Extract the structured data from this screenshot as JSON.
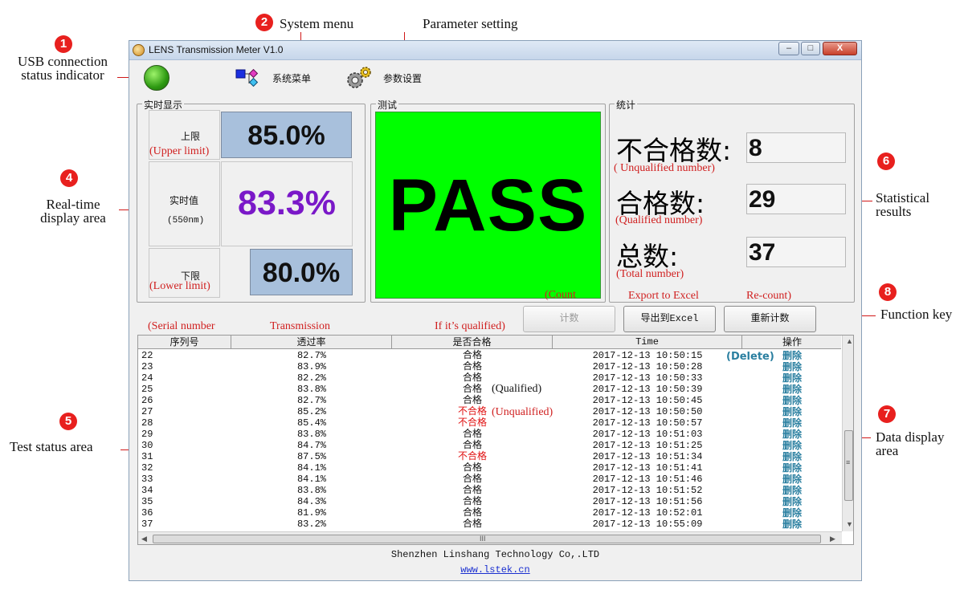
{
  "window": {
    "title": "LENS Transmission Meter V1.0",
    "minimize": "–",
    "maximize": "□",
    "close": "X"
  },
  "toolbar": {
    "system_menu": "系统菜单",
    "parameter_setting": "参数设置"
  },
  "realtime": {
    "group_title": "实时显示",
    "upper_label": "上限",
    "upper_value": "85.0%",
    "current_label": "实时值",
    "wavelength": "(550nm)",
    "current_value": "83.3%",
    "lower_label": "下限",
    "lower_value": "80.0%"
  },
  "test": {
    "group_title": "测试",
    "result": "PASS"
  },
  "stats": {
    "group_title": "统计",
    "unqualified_label": "不合格数:",
    "unqualified_value": "8",
    "qualified_label": "合格数:",
    "qualified_value": "29",
    "total_label": "总数:",
    "total_value": "37"
  },
  "function_buttons": {
    "count": "计数",
    "export": "导出到Excel",
    "recount": "重新计数"
  },
  "table": {
    "columns": [
      "序列号",
      "透过率",
      "是否合格",
      "Time",
      "操作"
    ],
    "rows": [
      {
        "id": "22",
        "trans": "82.7%",
        "status": "合格",
        "time": "2017-12-13  10:50:15",
        "action": "删除"
      },
      {
        "id": "23",
        "trans": "83.9%",
        "status": "合格",
        "time": "2017-12-13  10:50:28",
        "action": "删除"
      },
      {
        "id": "24",
        "trans": "82.2%",
        "status": "合格",
        "time": "2017-12-13  10:50:33",
        "action": "删除"
      },
      {
        "id": "25",
        "trans": "83.8%",
        "status": "合格",
        "time": "2017-12-13  10:50:39",
        "action": "删除"
      },
      {
        "id": "26",
        "trans": "82.7%",
        "status": "合格",
        "time": "2017-12-13  10:50:45",
        "action": "删除"
      },
      {
        "id": "27",
        "trans": "85.2%",
        "status": "不合格",
        "time": "2017-12-13  10:50:50",
        "action": "删除"
      },
      {
        "id": "28",
        "trans": "85.4%",
        "status": "不合格",
        "time": "2017-12-13  10:50:57",
        "action": "删除"
      },
      {
        "id": "29",
        "trans": "83.8%",
        "status": "合格",
        "time": "2017-12-13  10:51:03",
        "action": "删除"
      },
      {
        "id": "30",
        "trans": "84.7%",
        "status": "合格",
        "time": "2017-12-13  10:51:25",
        "action": "删除"
      },
      {
        "id": "31",
        "trans": "87.5%",
        "status": "不合格",
        "time": "2017-12-13  10:51:34",
        "action": "删除"
      },
      {
        "id": "32",
        "trans": "84.1%",
        "status": "合格",
        "time": "2017-12-13  10:51:41",
        "action": "删除"
      },
      {
        "id": "33",
        "trans": "84.1%",
        "status": "合格",
        "time": "2017-12-13  10:51:46",
        "action": "删除"
      },
      {
        "id": "34",
        "trans": "83.8%",
        "status": "合格",
        "time": "2017-12-13  10:51:52",
        "action": "删除"
      },
      {
        "id": "35",
        "trans": "84.3%",
        "status": "合格",
        "time": "2017-12-13  10:51:56",
        "action": "删除"
      },
      {
        "id": "36",
        "trans": "81.9%",
        "status": "合格",
        "time": "2017-12-13  10:52:01",
        "action": "删除"
      },
      {
        "id": "37",
        "trans": "83.2%",
        "status": "合格",
        "time": "2017-12-13  10:55:09",
        "action": "删除"
      }
    ],
    "hscroll_grip": "III",
    "vscroll_grip": "≡"
  },
  "footer": {
    "company": "Shenzhen Linshang Technology Co,.LTD",
    "url": "www.lstek.cn"
  },
  "annotations": {
    "badges": [
      "1",
      "2",
      "4",
      "5",
      "6",
      "7",
      "8"
    ],
    "usb": "USB connection status indicator",
    "system_menu": "System menu",
    "parameter_setting": "Parameter setting",
    "realtime": "Real-time display area",
    "test_status": "Test status area",
    "stats": "Statistical results",
    "data_display": "Data display area",
    "function_key": "Function key",
    "upper_limit": "(Upper limit)",
    "lower_limit": "(Lower limit)",
    "unqualified_number": "( Unqualified number)",
    "qualified_number": "(Qualified number)",
    "total_number": "(Total number)",
    "count": "(Count",
    "export": "Export to Excel",
    "recount": "Re-count)",
    "serial": "(Serial number",
    "transmission": "Transmission",
    "if_qualified": "If it’s qualified)",
    "delete": "(Delete)",
    "qualified": "(Qualified)",
    "unqualified": "(Unqualified)"
  },
  "colors": {
    "pass_bg": "#00ff00",
    "limit_box_bg": "#a8c0dc",
    "realtime_value": "#7a18c8",
    "unqualified_text": "#e01010",
    "delete_text": "#2a7fa0",
    "annotation_red": "#d02020"
  }
}
